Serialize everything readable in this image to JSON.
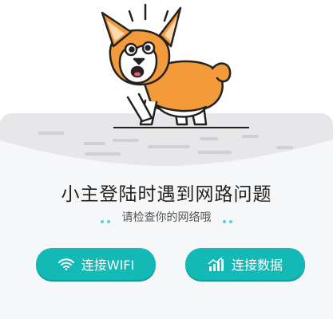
{
  "message": {
    "title": "小主登陆时遇到网路问题",
    "subtitle": "请检查你的网络哦"
  },
  "actions": {
    "wifi_label": "连接WIFI",
    "data_label": "连接数据"
  },
  "icons": {
    "wifi": "wifi-icon",
    "data": "signal-bars-icon",
    "illustration": "corgi-dog-illustration"
  },
  "colors": {
    "accent": "#12b9b5",
    "dot": "#4fd3df",
    "ground": "#e6e6e9",
    "background": "#f6f6f8",
    "corgi_orange": "#f39a3a"
  }
}
